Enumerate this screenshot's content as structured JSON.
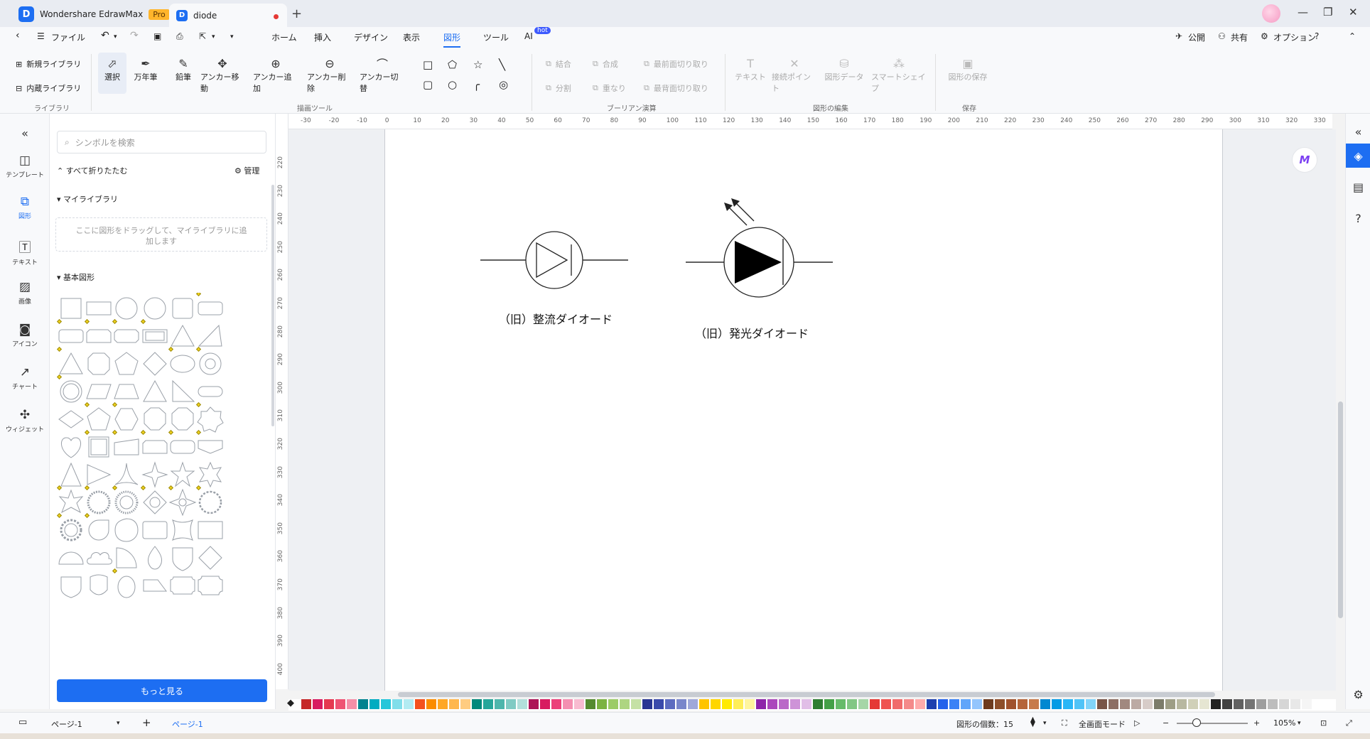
{
  "titlebar": {
    "app_name": "Wondershare EdrawMax",
    "pro_badge": "Pro",
    "doc_tab": "diode",
    "new_tab": "+",
    "minimize": "—",
    "restore": "❐",
    "close": "✕"
  },
  "menubar": {
    "file": "ファイル",
    "tabs": [
      "ホーム",
      "挿入",
      "デザイン",
      "表示",
      "図形",
      "ツール",
      "AI"
    ],
    "active_tab": "図形",
    "ai_badge": "hot",
    "publish": "公開",
    "share": "共有",
    "options": "オプション"
  },
  "ribbon": {
    "library": {
      "new_library": "新規ライブラリ",
      "builtin_library": "内蔵ライブラリ",
      "group": "ライブラリ"
    },
    "draw_tools": {
      "select": "選択",
      "pen": "万年筆",
      "pencil": "鉛筆",
      "move_anchor": "アンカー移動",
      "add_anchor": "アンカー追加",
      "delete_anchor": "アンカー削除",
      "toggle_anchor": "アンカー切替",
      "group": "描画ツール"
    },
    "boolean": {
      "union": "結合",
      "combine": "合成",
      "front_cut": "最前面切り取り",
      "split": "分割",
      "overlap": "重なり",
      "back_cut": "最背面切り取り",
      "group": "ブーリアン演算"
    },
    "edit_shape": {
      "text": "テキスト",
      "connect_point": "接続ポイント",
      "shape_data": "図形データ",
      "smart_shape": "スマートシェイプ",
      "group": "図形の編集"
    },
    "save": {
      "save_shape": "図形の保存",
      "group": "保存"
    }
  },
  "left_rail": [
    {
      "label": "テンプレート",
      "icon": "template-icon"
    },
    {
      "label": "図形",
      "icon": "shapes-icon"
    },
    {
      "label": "テキスト",
      "icon": "text-icon"
    },
    {
      "label": "画像",
      "icon": "image-icon"
    },
    {
      "label": "アイコン",
      "icon": "icon-icon"
    },
    {
      "label": "チャート",
      "icon": "chart-icon"
    },
    {
      "label": "ウィジェット",
      "icon": "widget-icon"
    }
  ],
  "library_panel": {
    "search_placeholder": "シンボルを検索",
    "collapse_all": "すべて折りたたむ",
    "manage": "管理",
    "my_library": "マイライブラリ",
    "drop_hint_line1": "ここに図形をドラッグして、マイライブラリに追",
    "drop_hint_line2": "加します",
    "basic_shapes": "基本図形",
    "more_button": "もっと見る"
  },
  "ruler": {
    "h_ticks": [
      "-30",
      "-20",
      "-10",
      "0",
      "10",
      "20",
      "30",
      "40",
      "50",
      "60",
      "70",
      "80",
      "90",
      "100",
      "110",
      "120",
      "130",
      "140",
      "150",
      "160",
      "170",
      "180",
      "190",
      "200",
      "210",
      "220",
      "230",
      "240",
      "250",
      "260",
      "270",
      "280",
      "290",
      "300",
      "310",
      "320",
      "330"
    ],
    "v_ticks": [
      "220",
      "230",
      "240",
      "250",
      "260",
      "270",
      "280",
      "290",
      "300",
      "310",
      "320",
      "330",
      "340",
      "350",
      "360",
      "370",
      "380",
      "390",
      "400"
    ]
  },
  "canvas": {
    "label_rectifier": "（旧）整流ダイオード",
    "label_led": "（旧）発光ダイオード"
  },
  "palette": [
    "#c62828",
    "#d81b60",
    "#e53950",
    "#ef5373",
    "#f48fa8",
    "#00838f",
    "#00acc1",
    "#26c6da",
    "#80deea",
    "#b2ebf2",
    "#f4511e",
    "#fb8c00",
    "#ffa726",
    "#ffb74d",
    "#ffcc80",
    "#00897b",
    "#26a69a",
    "#4db6ac",
    "#80cbc4",
    "#b2dfdb",
    "#ad1457",
    "#d81b60",
    "#ec407a",
    "#f48fb1",
    "#f8bbd0",
    "#558b2f",
    "#7cb342",
    "#9ccc65",
    "#aed581",
    "#c5e1a5",
    "#283593",
    "#3949ab",
    "#5c6bc0",
    "#7986cb",
    "#9fa8da",
    "#ffc400",
    "#ffd600",
    "#ffea00",
    "#ffee58",
    "#fff59d",
    "#8e24aa",
    "#ab47bc",
    "#ba68c8",
    "#ce93d8",
    "#e1bee7",
    "#2e7d32",
    "#43a047",
    "#66bb6a",
    "#81c784",
    "#a5d6a7",
    "#e53935",
    "#ef5350",
    "#f06b6b",
    "#f48a8a",
    "#ffabab",
    "#1e40af",
    "#2563eb",
    "#3b82f6",
    "#60a5fa",
    "#93c5fd",
    "#6d3b1f",
    "#8d4e2a",
    "#a0522d",
    "#b5653a",
    "#c77a4a",
    "#0288d1",
    "#039be5",
    "#29b6f6",
    "#4fc3f7",
    "#81d4fa",
    "#795548",
    "#8d6e63",
    "#a1887f",
    "#bcaaa4",
    "#d7ccc8",
    "#7c7c6a",
    "#9e9e86",
    "#b8b8a0",
    "#d0d0b8",
    "#e6e6d2",
    "#212121",
    "#424242",
    "#616161",
    "#757575",
    "#9e9e9e",
    "#bdbdbd",
    "#d6d6d6",
    "#e8e8e8",
    "#f5f5f5",
    "#ffffff"
  ],
  "statusbar": {
    "page_selector": "ページ-1",
    "add_page": "+",
    "current_page": "ページ-1",
    "shape_count": "図形の個数：15",
    "fullscreen": "全画面モード",
    "zoom": "105%"
  }
}
